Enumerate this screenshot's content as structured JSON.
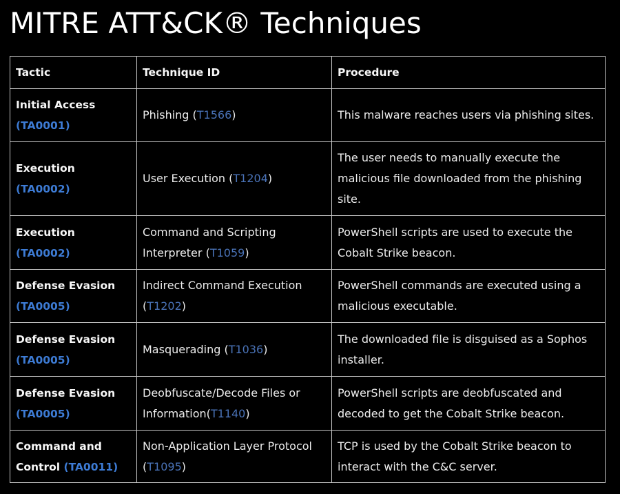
{
  "title": "MITRE ATT&CK® Techniques",
  "table": {
    "headers": [
      "Tactic",
      "Technique ID",
      "Procedure"
    ],
    "rows": [
      {
        "tactic": "Initial Access",
        "tactic_id": "(TA0001)",
        "technique": "Phishing (",
        "technique_id": "T1566",
        "technique_close": ")",
        "procedure": "This malware reaches users via phishing sites."
      },
      {
        "tactic": "Execution",
        "tactic_id": "(TA0002)",
        "technique": "User Execution (",
        "technique_id": "T1204",
        "technique_close": ")",
        "procedure": "The user needs to manually execute the malicious file downloaded from the phishing site."
      },
      {
        "tactic": "Execution",
        "tactic_id": "(TA0002)",
        "technique": "Command and Scripting Interpreter (",
        "technique_id": "T1059",
        "technique_close": ")",
        "procedure": "PowerShell scripts are used to execute the Cobalt Strike beacon."
      },
      {
        "tactic": "Defense Evasion",
        "tactic_id": "(TA0005)",
        "technique": "Indirect Command Execution (",
        "technique_id": "T1202",
        "technique_close": ")",
        "procedure": "PowerShell commands are executed using a malicious executable."
      },
      {
        "tactic": "Defense Evasion",
        "tactic_id": "(TA0005)",
        "technique": "Masquerading (",
        "technique_id": "T1036",
        "technique_close": ")",
        "procedure": "The downloaded file is disguised as a Sophos installer."
      },
      {
        "tactic": "Defense Evasion",
        "tactic_id": "(TA0005)",
        "technique": "Deobfuscate/Decode Files or Information(",
        "technique_id": "T1140",
        "technique_close": ")",
        "procedure": "PowerShell scripts are deobfuscated and decoded to get the Cobalt Strike beacon."
      },
      {
        "tactic": "Command and Control",
        "tactic_id": "(TA0011)",
        "technique": "Non-Application Layer Protocol (",
        "technique_id": "T1095",
        "technique_close": ")",
        "procedure": "TCP is used by the Cobalt Strike beacon to interact with the C&C server."
      }
    ]
  },
  "colors": {
    "tactic_id": "#3d7bd4",
    "technique_id": "#4a73b8",
    "background": "#000000",
    "border": "#c8c8c8"
  }
}
